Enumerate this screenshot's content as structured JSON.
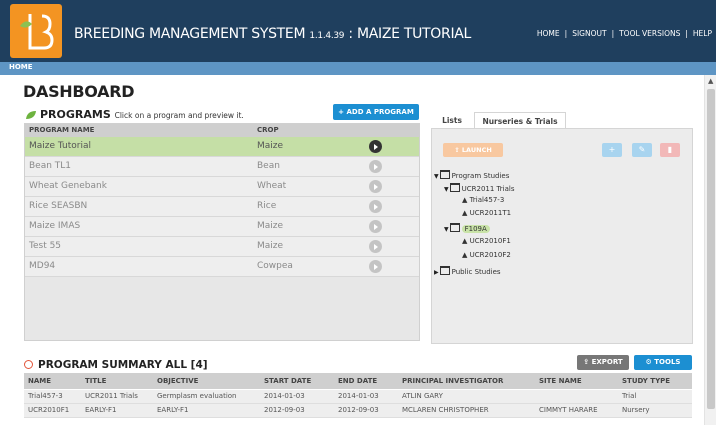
{
  "header": {
    "app_name": "BREEDING MANAGEMENT SYSTEM",
    "version": "1.1.4.39",
    "separator": " : ",
    "context": "MAIZE TUTORIAL",
    "nav": [
      "HOME",
      "SIGNOUT",
      "TOOL VERSIONS",
      "HELP"
    ],
    "nav_separator": "|"
  },
  "breadcrumb": {
    "home": "HOME"
  },
  "dashboard": {
    "title": "DASHBOARD"
  },
  "programs": {
    "title": "PROGRAMS",
    "hint": "Click on a program and preview it.",
    "add_button": "ADD A PROGRAM",
    "columns": {
      "name": "PROGRAM NAME",
      "crop": "CROP"
    },
    "rows": [
      {
        "name": "Maize Tutorial",
        "crop": "Maize",
        "selected": true
      },
      {
        "name": "Bean TL1",
        "crop": "Bean",
        "selected": false
      },
      {
        "name": "Wheat Genebank",
        "crop": "Wheat",
        "selected": false
      },
      {
        "name": "Rice SEASBN",
        "crop": "Rice",
        "selected": false
      },
      {
        "name": "Maize IMAS",
        "crop": "Maize",
        "selected": false
      },
      {
        "name": "Test 55",
        "crop": "Maize",
        "selected": false
      },
      {
        "name": "MD94",
        "crop": "Cowpea",
        "selected": false
      }
    ]
  },
  "side_panel": {
    "tabs": {
      "lists": "Lists",
      "nurseries_trials": "Nurseries & Trials"
    },
    "launch": "LAUNCH",
    "tree": {
      "program_studies": "Program Studies",
      "ucr2011": "UCR2011 Trials",
      "trial457": "Trial457-3",
      "ucr2011t1": "UCR2011T1",
      "f109a": "F109A",
      "ucr2010f1": "UCR2010F1",
      "ucr2010f2": "UCR2010F2",
      "public_studies": "Public Studies"
    }
  },
  "summary": {
    "title": "PROGRAM SUMMARY ALL [4]",
    "export": "EXPORT",
    "tools": "TOOLS",
    "columns": {
      "name": "NAME",
      "title": "TITLE",
      "objective": "OBJECTIVE",
      "start": "START DATE",
      "end": "END DATE",
      "pi": "PRINCIPAL INVESTIGATOR",
      "site": "SITE NAME",
      "type": "STUDY TYPE"
    },
    "rows": [
      {
        "name": "Trial457-3",
        "title": "UCR2011 Trials",
        "objective": "Germplasm evaluation",
        "start": "2014-01-03",
        "end": "2014-01-03",
        "pi": "ATLIN GARY",
        "site": "",
        "type": "Trial"
      },
      {
        "name": "UCR2010F1",
        "title": "EARLY-F1",
        "objective": "EARLY-F1",
        "start": "2012-09-03",
        "end": "2012-09-03",
        "pi": "MCLAREN CHRISTOPHER",
        "site": "CIMMYT HARARE",
        "type": "Nursery"
      }
    ]
  },
  "colors": {
    "header_bg": "#1f3f5e",
    "logo": "#f39422",
    "accent_blue": "#1c8fd2",
    "selected_row": "#c5dfa6"
  },
  "icons": {
    "leaf": "leaf-icon",
    "play": "play-icon",
    "folder": "folder-icon",
    "flask": "flask-icon",
    "gear": "gear-icon"
  }
}
